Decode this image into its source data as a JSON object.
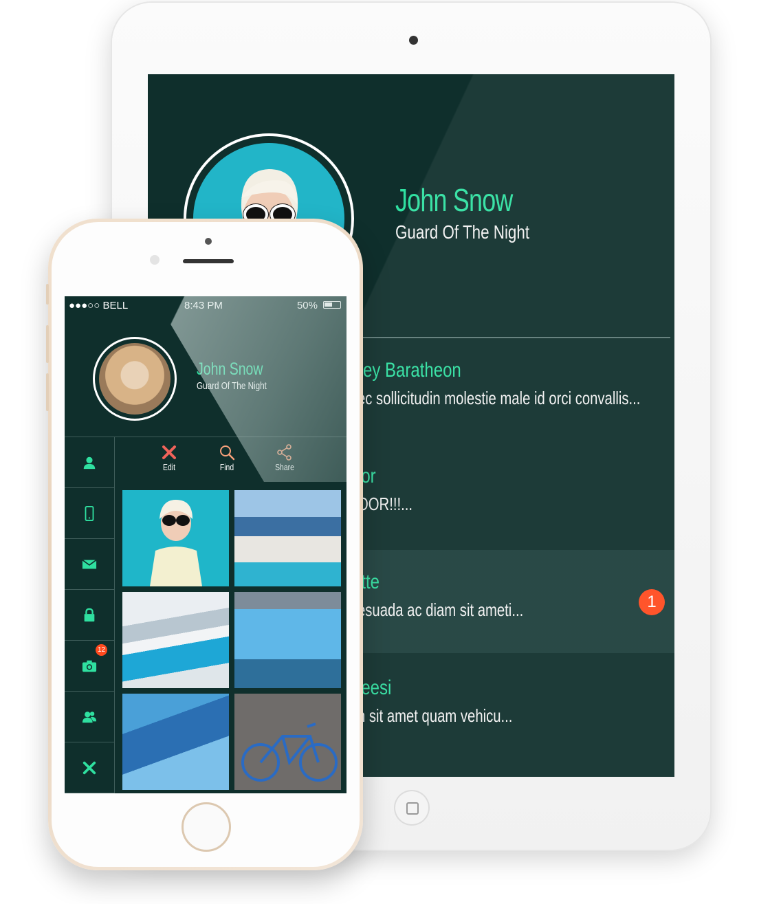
{
  "tablet": {
    "profile": {
      "name": "John Snow",
      "subtitle": "Guard Of The Night"
    },
    "messages": [
      {
        "name": "rey Baratheon",
        "text": "ec sollicitudin molestie male id orci convallis...",
        "badge": ""
      },
      {
        "name": "lor",
        "text": "OOR!!!...",
        "badge": ""
      },
      {
        "name": "itte",
        "text": "esuada ac diam sit ameti...",
        "badge": "1"
      },
      {
        "name": "leesi",
        "text": "n sit amet quam vehicu...",
        "badge": ""
      }
    ]
  },
  "phone": {
    "status": {
      "carrier": "●●●○○ BELL",
      "time": "8:43 PM",
      "battery": "50%"
    },
    "profile": {
      "name": "John Snow",
      "subtitle": "Guard Of The Night"
    },
    "sidebar": [
      {
        "icon": "user-icon",
        "badge": ""
      },
      {
        "icon": "mobile-icon",
        "badge": ""
      },
      {
        "icon": "mail-icon",
        "badge": ""
      },
      {
        "icon": "lock-icon",
        "badge": ""
      },
      {
        "icon": "camera-icon",
        "badge": "12"
      },
      {
        "icon": "users-icon",
        "badge": ""
      },
      {
        "icon": "tools-icon",
        "badge": ""
      }
    ],
    "actions": [
      {
        "label": "Edit",
        "icon": "close-icon",
        "color": "#f0635a"
      },
      {
        "label": "Find",
        "icon": "search-icon",
        "color": "#f6a07a"
      },
      {
        "label": "Share",
        "icon": "share-icon",
        "color": "#f6a07a"
      }
    ],
    "gallery": [
      {
        "name": "woman-with-sunglasses"
      },
      {
        "name": "santorini-pool"
      },
      {
        "name": "glacier-river"
      },
      {
        "name": "blue-iceberg"
      },
      {
        "name": "blue-stairs"
      },
      {
        "name": "blue-bicycle"
      }
    ]
  },
  "colors": {
    "accent": "#2fe0a0",
    "screen": "#0f2f2c",
    "badge": "#ff4a1e"
  }
}
